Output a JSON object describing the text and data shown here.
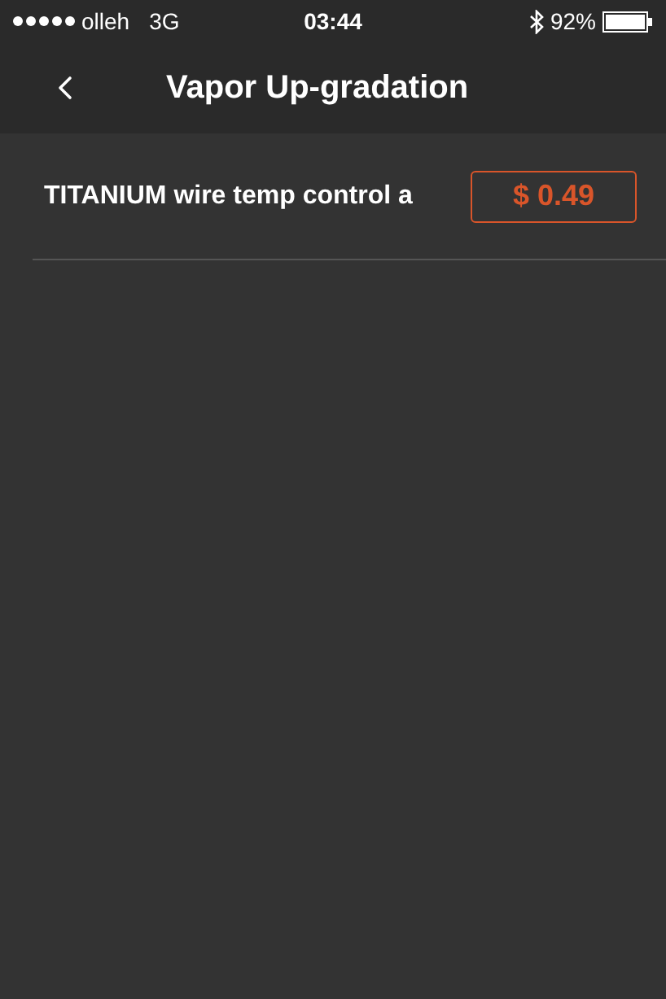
{
  "status_bar": {
    "carrier": "olleh",
    "network": "3G",
    "time": "03:44",
    "battery": "92%"
  },
  "nav_bar": {
    "title": "Vapor Up-gradation"
  },
  "items": [
    {
      "name": "TITANIUM wire temp control a",
      "price": "$ 0.49"
    }
  ]
}
